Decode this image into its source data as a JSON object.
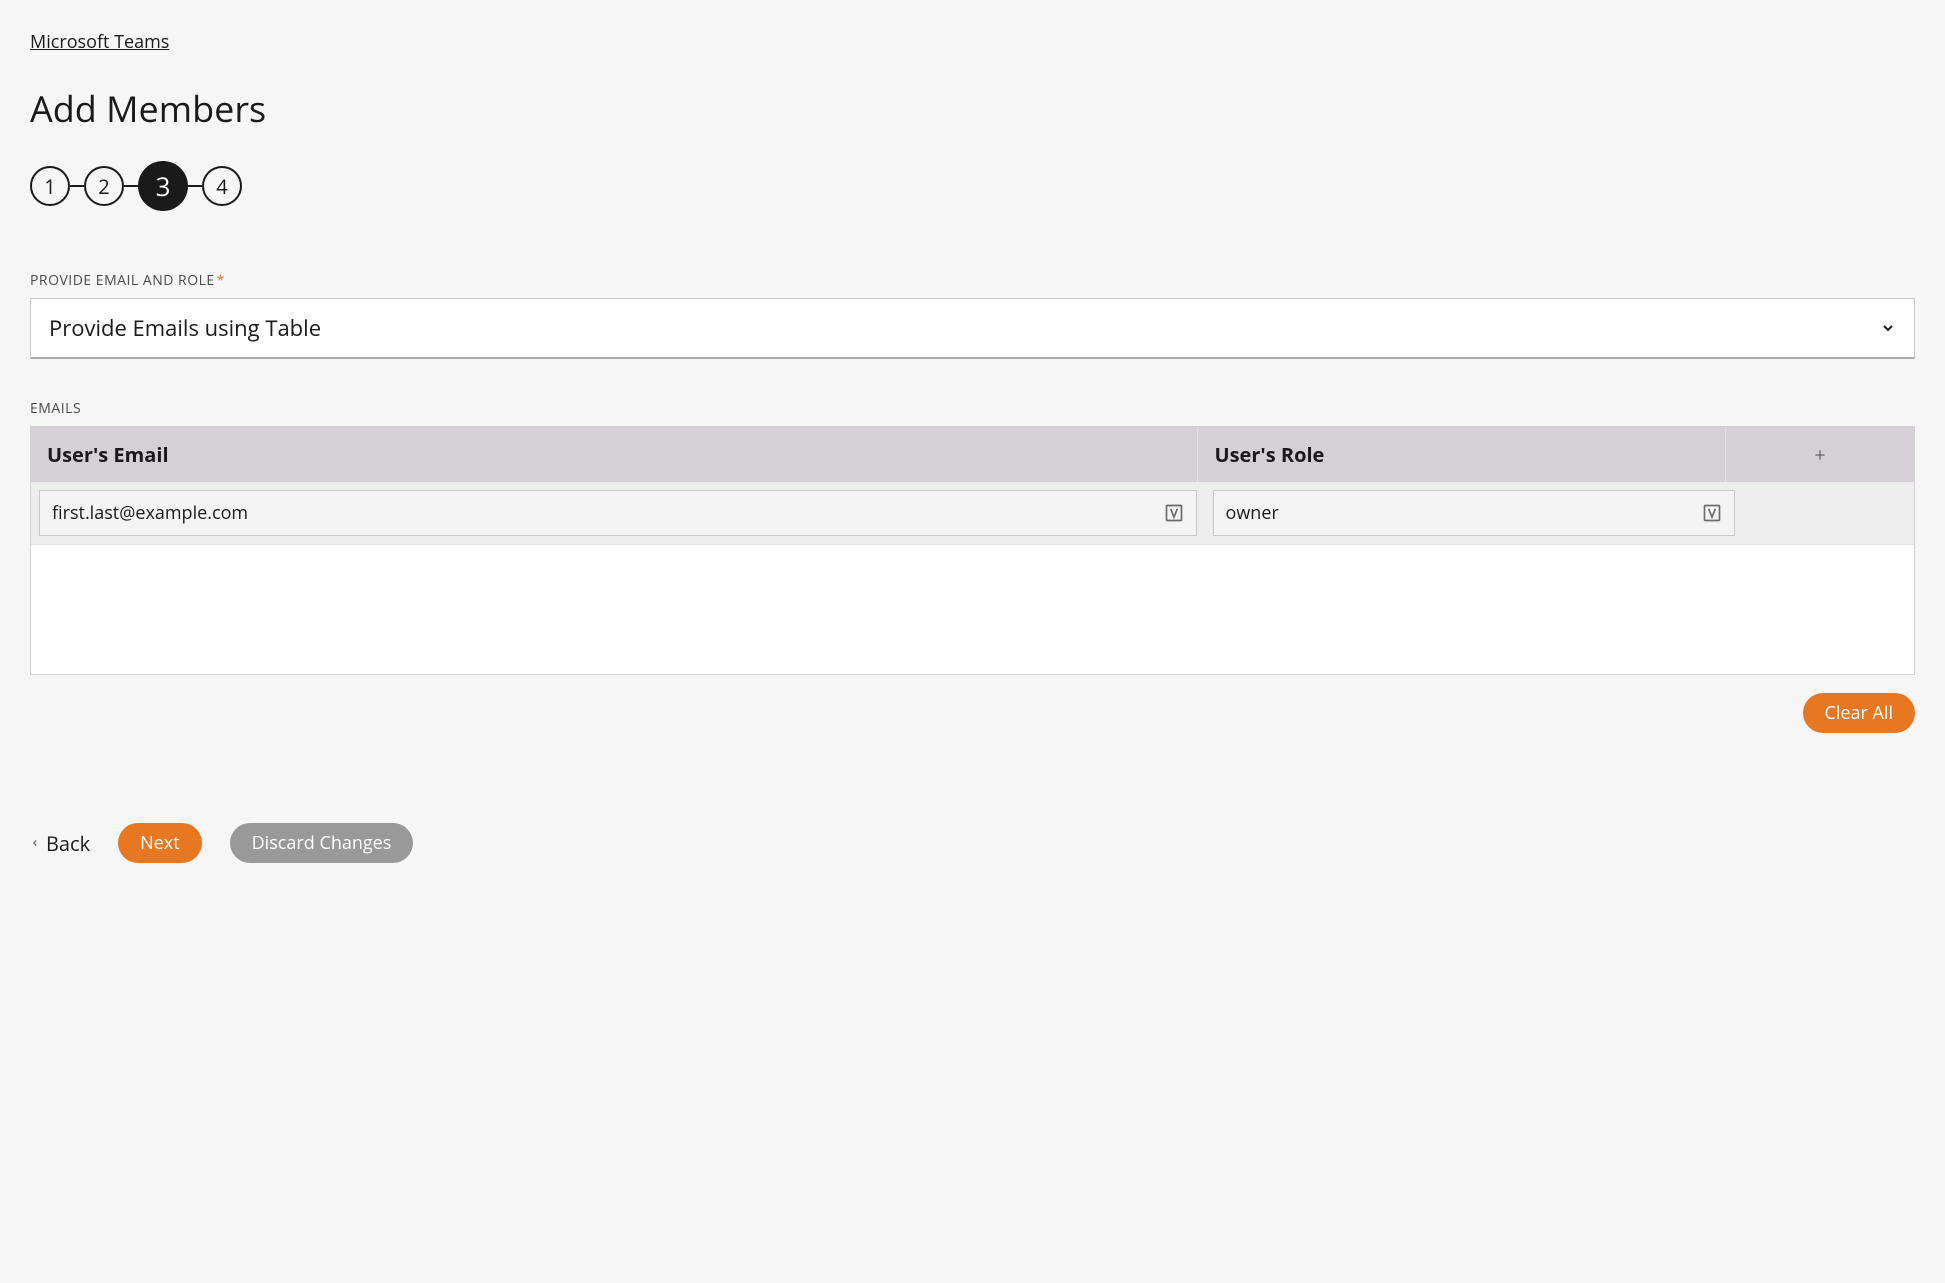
{
  "breadcrumb": "Microsoft Teams",
  "page_title": "Add Members",
  "stepper": {
    "steps": [
      "1",
      "2",
      "3",
      "4"
    ],
    "active_index": 2
  },
  "section": {
    "label": "PROVIDE EMAIL AND ROLE",
    "required_mark": "*",
    "dropdown_value": "Provide Emails using Table"
  },
  "emails": {
    "label": "EMAILS",
    "columns": {
      "email": "User's Email",
      "role": "User's Role"
    },
    "rows": [
      {
        "email": "first.last@example.com",
        "role": "owner"
      }
    ],
    "clear_all": "Clear All"
  },
  "footer": {
    "back": "Back",
    "next": "Next",
    "discard": "Discard Changes"
  }
}
